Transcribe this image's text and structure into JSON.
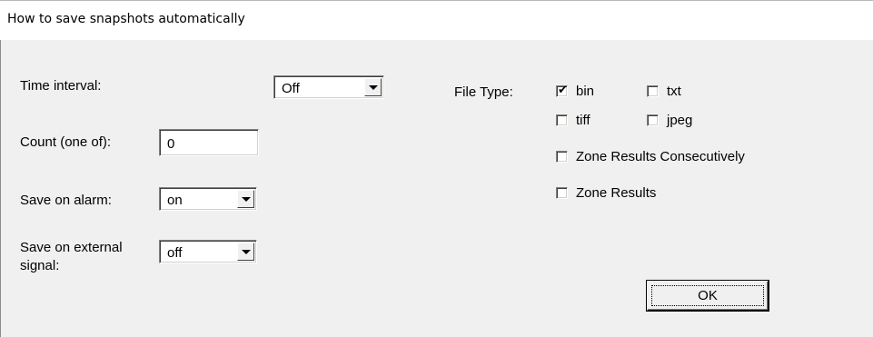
{
  "window": {
    "title": "How to save snapshots automatically"
  },
  "fields": {
    "time_interval": {
      "label": "Time interval:",
      "value": "Off"
    },
    "count": {
      "label": "Count (one of):",
      "value": "0"
    },
    "save_on_alarm": {
      "label": "Save on alarm:",
      "value": "on"
    },
    "save_on_external": {
      "label": "Save on external signal:",
      "value": "off"
    }
  },
  "file_type": {
    "label": "File Type:",
    "options": [
      {
        "label": "bin",
        "checked": true
      },
      {
        "label": "txt",
        "checked": false
      },
      {
        "label": "tiff",
        "checked": false
      },
      {
        "label": "jpeg",
        "checked": false
      }
    ]
  },
  "extra_options": [
    {
      "label": "Zone Results Consecutively",
      "checked": false
    },
    {
      "label": "Zone Results",
      "checked": false
    }
  ],
  "buttons": {
    "ok": "OK"
  },
  "icons": {
    "checkmark": "✔"
  }
}
